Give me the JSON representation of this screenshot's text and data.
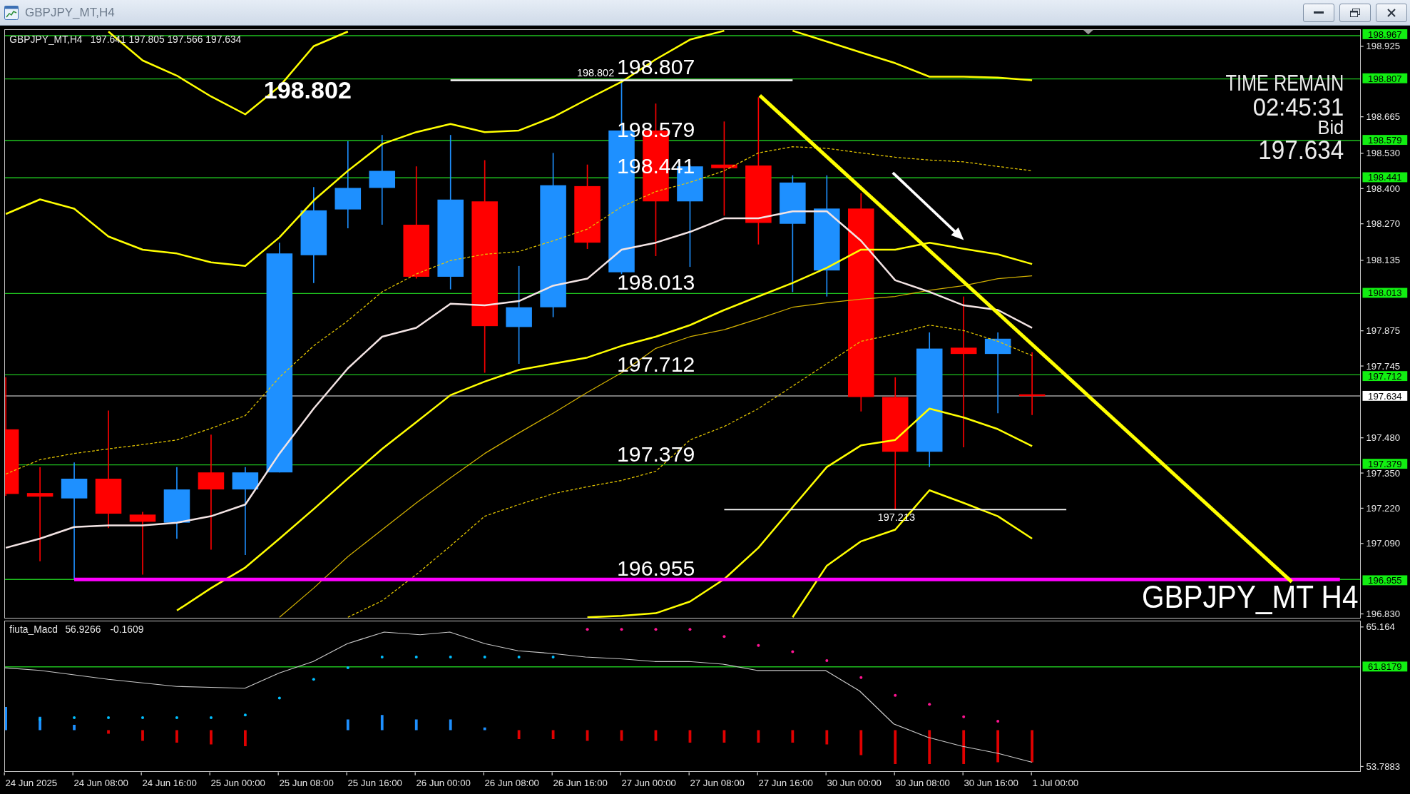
{
  "window": {
    "title": "GBPJPY_MT,H4"
  },
  "chart": {
    "info": {
      "symbol": "GBPJPY_MT,H4",
      "values": "197.641 197.805 197.566 197.634"
    },
    "labels": [
      {
        "kind": "large",
        "text": "198.807"
      },
      {
        "kind": "small",
        "text": "198.802"
      },
      {
        "kind": "bold",
        "text": "198.802"
      },
      {
        "kind": "large",
        "text": "198.579"
      },
      {
        "kind": "large",
        "text": "198.441"
      },
      {
        "kind": "large",
        "text": "198.013"
      },
      {
        "kind": "large",
        "text": "197.712"
      },
      {
        "kind": "large",
        "text": "197.379"
      },
      {
        "kind": "small",
        "text": "197.213"
      },
      {
        "kind": "large",
        "text": "196.955"
      }
    ],
    "timer": {
      "title": "TIME REMAIN",
      "countdown": "02:45:31",
      "price_label": "Bid",
      "price": "197.634"
    },
    "symbol_label": "GBPJPY_MT H4",
    "price_tags": [
      {
        "kind": "level",
        "text": "198.967"
      },
      {
        "kind": "level",
        "text": "198.807"
      },
      {
        "kind": "level",
        "text": "198.579"
      },
      {
        "kind": "level",
        "text": "198.441"
      },
      {
        "kind": "level",
        "text": "198.013"
      },
      {
        "kind": "level",
        "text": "197.712"
      },
      {
        "kind": "bid",
        "text": "197.634"
      },
      {
        "kind": "level",
        "text": "197.379"
      },
      {
        "kind": "level",
        "text": "196.955"
      }
    ],
    "chart_data": {
      "type": "line",
      "categories": [
        null,
        null,
        null,
        null,
        null,
        null,
        null,
        null,
        null,
        null,
        null,
        null,
        null,
        null,
        null,
        null,
        null,
        null,
        null,
        null,
        null,
        null,
        null,
        null,
        null,
        null,
        null,
        null,
        null,
        null,
        null,
        null,
        null,
        null,
        null,
        null,
        null,
        null,
        null,
        null
      ],
      "ylim": [
        196.813,
        198.988
      ],
      "yticks": [
        {
          "value": 198.925,
          "label": "198.925"
        },
        {
          "value": 198.665,
          "label": "198.665"
        },
        {
          "value": 198.53,
          "label": "198.530"
        },
        {
          "value": 198.4,
          "label": "198.400"
        },
        {
          "value": 198.27,
          "label": "198.270"
        },
        {
          "value": 198.135,
          "label": "198.135"
        },
        {
          "value": 197.875,
          "label": "197.875"
        },
        {
          "value": 197.745,
          "label": "197.745"
        },
        {
          "value": 197.48,
          "label": "197.480"
        },
        {
          "value": 197.35,
          "label": "197.350"
        },
        {
          "value": 197.22,
          "label": "197.220"
        },
        {
          "value": 197.09,
          "label": "197.090"
        },
        {
          "value": 196.83,
          "label": "196.830"
        }
      ],
      "ref_lines": [
        {
          "axis": "y",
          "value": 198.967,
          "color": "#1fc21f"
        },
        {
          "axis": "y",
          "value": 198.807,
          "color": "#1fc21f"
        },
        {
          "axis": "y",
          "value": 198.579,
          "color": "#1fc21f"
        },
        {
          "axis": "y",
          "value": 198.441,
          "color": "#1fc21f"
        },
        {
          "axis": "y",
          "value": 198.013,
          "color": "#1fc21f"
        },
        {
          "axis": "y",
          "value": 197.712,
          "color": "#1fc21f"
        },
        {
          "axis": "y",
          "value": 197.634,
          "color": "#a0a0a0"
        },
        {
          "axis": "y",
          "value": 197.379,
          "color": "#1fc21f"
        },
        {
          "axis": "y",
          "value": 196.955,
          "color": "#1fc21f"
        }
      ],
      "series": [
        {
          "color": "#ffff00",
          "values": [
            null,
            null,
            null,
            198.982,
            198.875,
            198.819,
            198.742,
            198.676,
            198.779,
            198.928,
            198.982,
            null,
            null,
            null,
            null,
            null,
            null,
            null,
            null,
            null,
            null,
            null,
            null,
            198.985,
            198.945,
            198.905,
            198.865,
            198.815,
            198.815,
            198.812,
            198.802,
            null,
            null,
            null,
            null,
            null,
            null,
            null,
            null,
            null
          ]
        },
        {
          "color": "#ffff00",
          "values": [
            198.307,
            198.361,
            198.327,
            198.224,
            198.175,
            198.161,
            198.128,
            198.115,
            198.221,
            198.357,
            198.467,
            198.566,
            198.61,
            198.64,
            198.61,
            198.616,
            198.666,
            198.732,
            198.796,
            198.879,
            198.952,
            198.985,
            null,
            null,
            null,
            null,
            null,
            null,
            null,
            null,
            null,
            null,
            null,
            null,
            null,
            null,
            null,
            null,
            null,
            null
          ]
        },
        {
          "color": "#ffff00",
          "values": [
            null,
            null,
            null,
            null,
            null,
            196.84,
            196.923,
            196.999,
            197.106,
            197.215,
            197.328,
            197.438,
            197.537,
            197.637,
            197.687,
            197.73,
            197.753,
            197.776,
            197.819,
            197.853,
            197.896,
            197.952,
            198.002,
            198.052,
            198.108,
            198.175,
            198.175,
            198.201,
            198.178,
            198.158,
            198.122,
            null,
            null,
            null,
            null,
            null,
            null,
            null,
            null,
            null
          ]
        },
        {
          "color": "#ffff00",
          "values": [
            null,
            null,
            null,
            null,
            null,
            null,
            null,
            null,
            null,
            null,
            null,
            null,
            null,
            null,
            null,
            null,
            null,
            196.815,
            196.82,
            196.83,
            196.873,
            196.956,
            197.072,
            197.222,
            197.371,
            197.451,
            197.471,
            197.587,
            197.554,
            197.511,
            197.448,
            null,
            null,
            null,
            null,
            null,
            null,
            null,
            null,
            null
          ]
        },
        {
          "color": "#ffff00",
          "values": [
            null,
            null,
            null,
            null,
            null,
            null,
            null,
            null,
            null,
            null,
            null,
            null,
            null,
            null,
            null,
            null,
            null,
            null,
            null,
            null,
            null,
            null,
            null,
            196.815,
            197.006,
            197.096,
            197.139,
            197.285,
            197.238,
            197.189,
            197.106,
            null,
            null,
            null,
            null,
            null,
            null,
            null,
            null,
            null
          ]
        },
        {
          "color": "#d2b100",
          "values": [
            null,
            null,
            null,
            null,
            null,
            null,
            null,
            null,
            196.815,
            196.923,
            197.039,
            197.139,
            197.238,
            197.331,
            197.421,
            197.497,
            197.57,
            197.647,
            197.72,
            197.81,
            197.853,
            197.879,
            197.919,
            197.962,
            197.979,
            197.992,
            198.002,
            198.025,
            198.042,
            198.068,
            198.078,
            null,
            null,
            null,
            null,
            null,
            null,
            null,
            null,
            null
          ]
        },
        {
          "color": "#e6c800",
          "line_style": "dashed",
          "values": [
            197.345,
            197.398,
            197.421,
            197.438,
            197.454,
            197.471,
            197.514,
            197.561,
            197.703,
            197.819,
            197.912,
            198.019,
            198.085,
            198.135,
            198.158,
            198.168,
            198.208,
            198.251,
            198.334,
            198.39,
            198.424,
            198.467,
            198.533,
            198.556,
            198.55,
            198.533,
            198.517,
            198.507,
            198.5,
            198.483,
            198.467,
            null,
            null,
            null,
            null,
            null,
            null,
            null,
            null,
            null
          ]
        },
        {
          "color": "#e6c800",
          "line_style": "dashed",
          "values": [
            null,
            null,
            null,
            null,
            null,
            null,
            null,
            null,
            null,
            null,
            196.815,
            196.876,
            196.973,
            197.079,
            197.189,
            197.232,
            197.272,
            197.298,
            197.321,
            197.355,
            197.471,
            197.521,
            197.587,
            197.67,
            197.753,
            197.836,
            197.863,
            197.896,
            197.876,
            197.836,
            197.783,
            null,
            null,
            null,
            null,
            null,
            null,
            null,
            null,
            null
          ]
        },
        {
          "color": "#f3e4e4",
          "values": [
            197.072,
            197.106,
            197.149,
            197.155,
            197.155,
            197.165,
            197.189,
            197.232,
            197.421,
            197.587,
            197.736,
            197.853,
            197.886,
            197.975,
            197.969,
            197.985,
            198.042,
            198.068,
            198.175,
            198.201,
            198.241,
            198.291,
            198.291,
            198.317,
            198.317,
            198.208,
            198.062,
            198.019,
            197.969,
            197.952,
            197.886,
            null,
            null,
            null,
            null,
            null,
            null,
            null,
            null,
            null
          ]
        },
        {
          "color": "#ffffff",
          "values": [
            null,
            null,
            null,
            null,
            null,
            null,
            null,
            null,
            null,
            null,
            null,
            null,
            null,
            198.802,
            198.802,
            198.802,
            198.802,
            198.802,
            198.802,
            198.802,
            198.802,
            198.802,
            198.802,
            198.802,
            null,
            null,
            null,
            null,
            null,
            null,
            null,
            null,
            null,
            null,
            null,
            null,
            null,
            null,
            null,
            null
          ]
        },
        {
          "color": "#ffffff",
          "values": [
            null,
            null,
            null,
            null,
            null,
            null,
            null,
            null,
            null,
            null,
            null,
            null,
            null,
            null,
            null,
            null,
            null,
            null,
            null,
            null,
            null,
            197.213,
            197.213,
            197.213,
            197.213,
            197.213,
            197.213,
            197.213,
            197.213,
            197.213,
            197.213,
            197.213,
            null,
            null,
            null,
            null,
            null,
            null,
            null,
            null
          ]
        },
        {
          "color": "#ff00ff",
          "values": [
            null,
            null,
            196.955,
            196.955,
            196.955,
            196.955,
            196.955,
            196.955,
            196.955,
            196.955,
            196.955,
            196.955,
            196.955,
            196.955,
            196.955,
            196.955,
            196.955,
            196.955,
            196.955,
            196.955,
            196.955,
            196.955,
            196.955,
            196.955,
            196.955,
            196.955,
            196.955,
            196.955,
            196.955,
            196.955,
            196.955,
            196.955,
            196.955,
            196.955,
            196.955,
            196.955,
            196.955,
            196.955,
            196.955,
            196.955
          ]
        }
      ]
    }
  },
  "indicator": {
    "name": "fiuta_Macd",
    "values": [
      "56.9266",
      "-0.1609"
    ],
    "axis": [
      {
        "kind": "tick",
        "text": "65.164"
      },
      {
        "kind": "level",
        "text": "61.8179"
      },
      {
        "kind": "tick",
        "text": "53.7883"
      }
    ]
  },
  "time_axis": [
    "24 Jun 2025",
    "24 Jun 08:00",
    "24 Jun 16:00",
    "25 Jun 00:00",
    "25 Jun 08:00",
    "25 Jun 16:00",
    "26 Jun 00:00",
    "26 Jun 08:00",
    "26 Jun 16:00",
    "27 Jun 00:00",
    "27 Jun 08:00",
    "27 Jun 16:00",
    "30 Jun 00:00",
    "30 Jun 08:00",
    "30 Jun 16:00",
    "1 Jul 00:00"
  ]
}
